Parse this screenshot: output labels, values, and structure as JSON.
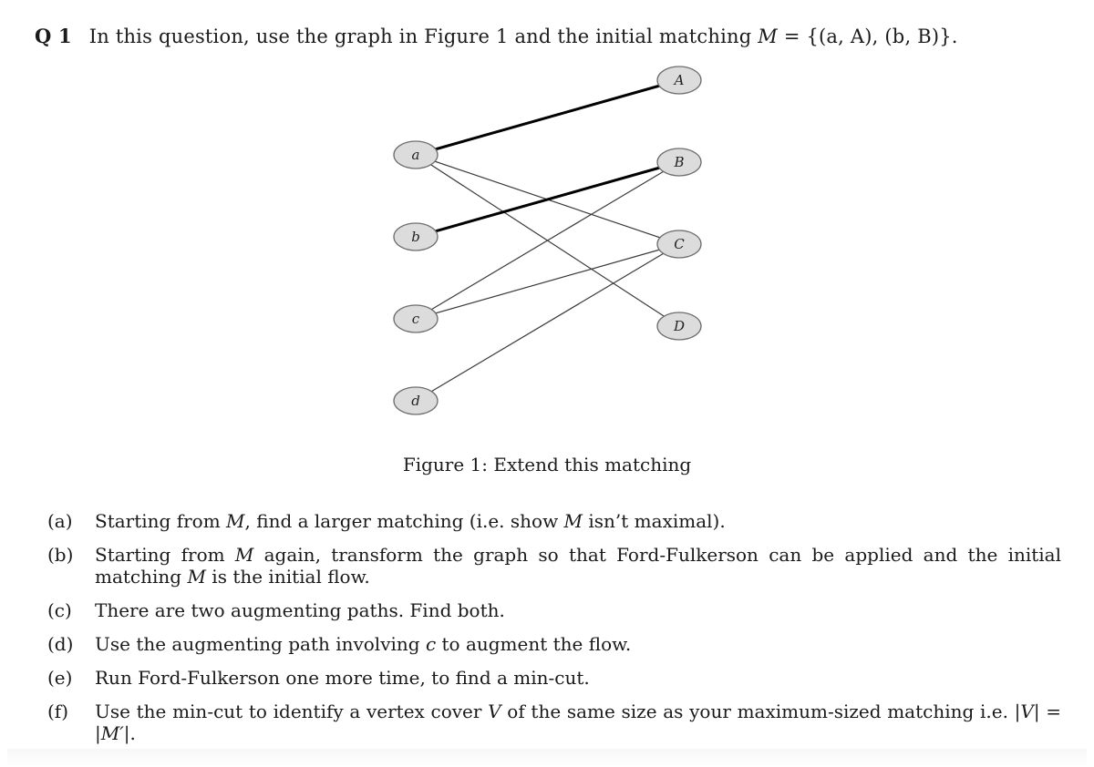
{
  "question": {
    "number": "Q 1",
    "intro": "In this question, use the graph in Figure 1 and the initial matching ",
    "matching_symbol": "M",
    "matching_value": " = {(a, A), (b, B)}."
  },
  "figure": {
    "caption": "Figure 1: Extend this matching",
    "left_nodes": [
      "a",
      "b",
      "c",
      "d"
    ],
    "right_nodes": [
      "A",
      "B",
      "C",
      "D"
    ],
    "edges": [
      {
        "from": "a",
        "to": "A",
        "matched": true
      },
      {
        "from": "a",
        "to": "C",
        "matched": false
      },
      {
        "from": "a",
        "to": "D",
        "matched": false
      },
      {
        "from": "b",
        "to": "B",
        "matched": true
      },
      {
        "from": "c",
        "to": "B",
        "matched": false
      },
      {
        "from": "c",
        "to": "C",
        "matched": false
      },
      {
        "from": "d",
        "to": "C",
        "matched": false
      }
    ],
    "node_fill": "#dcdcdc",
    "node_stroke": "#6e6e6e"
  },
  "parts": [
    {
      "label": "(a)",
      "text": "Starting from M, find a larger matching (i.e. show M isn’t maximal)."
    },
    {
      "label": "(b)",
      "text": "Starting from M again, transform the graph so that Ford-Fulkerson can be applied and the initial matching M is the initial flow."
    },
    {
      "label": "(c)",
      "text": "There are two augmenting paths. Find both."
    },
    {
      "label": "(d)",
      "text": "Use the augmenting path involving c to augment the flow."
    },
    {
      "label": "(e)",
      "text": "Run Ford-Fulkerson one more time, to find a min-cut."
    },
    {
      "label": "(f)",
      "text": "Use the min-cut to identify a vertex cover V of the same size as your maximum-sized matching i.e. |V| = |M′|."
    }
  ]
}
